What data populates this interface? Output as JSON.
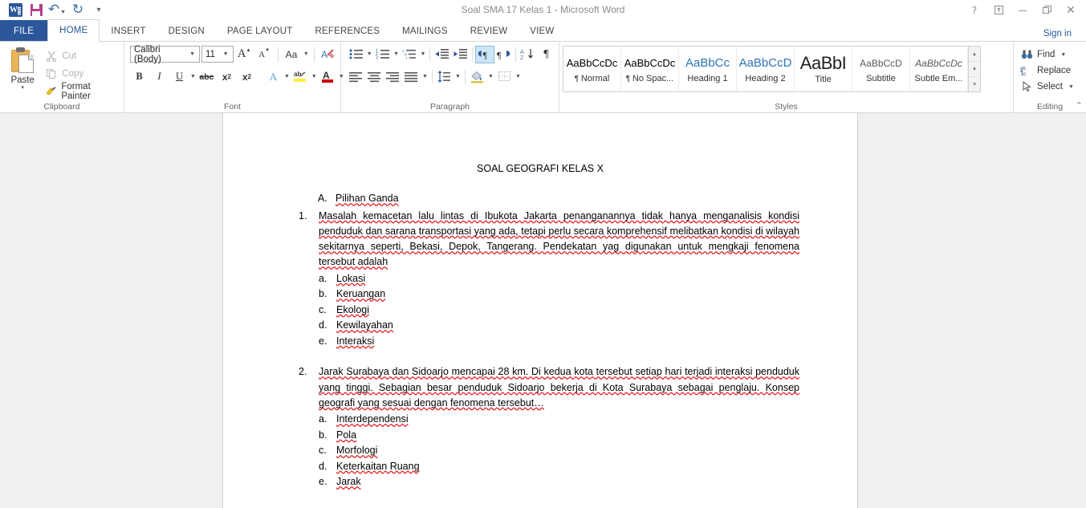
{
  "window": {
    "title": "Soal SMA 17 Kelas 1 - Microsoft Word",
    "quick_access": [
      {
        "name": "word-logo",
        "label": "W"
      },
      {
        "name": "save",
        "label": "Save"
      },
      {
        "name": "undo",
        "label": "↶"
      },
      {
        "name": "redo",
        "label": "↻"
      },
      {
        "name": "customize",
        "label": "–"
      }
    ],
    "controls": {
      "help": "?",
      "ribbon_display_options": "⤒",
      "minimize": "—",
      "restore": "❐",
      "close": "✕"
    },
    "sign_in": "Sign in"
  },
  "tabs": [
    {
      "label": "FILE",
      "active": false,
      "file": true
    },
    {
      "label": "HOME",
      "active": true,
      "file": false
    },
    {
      "label": "INSERT",
      "active": false,
      "file": false
    },
    {
      "label": "DESIGN",
      "active": false,
      "file": false
    },
    {
      "label": "PAGE LAYOUT",
      "active": false,
      "file": false
    },
    {
      "label": "REFERENCES",
      "active": false,
      "file": false
    },
    {
      "label": "MAILINGS",
      "active": false,
      "file": false
    },
    {
      "label": "REVIEW",
      "active": false,
      "file": false
    },
    {
      "label": "VIEW",
      "active": false,
      "file": false
    }
  ],
  "ribbon": {
    "collapse_label": "⌃",
    "clipboard": {
      "group_label": "Clipboard",
      "paste_label": "Paste",
      "paste_arrow": "▾",
      "commands": [
        {
          "label": "Cut",
          "icon": "scissors-icon",
          "glyph": "✂",
          "disabled": true
        },
        {
          "label": "Copy",
          "icon": "copy-icon",
          "glyph": "⧉",
          "disabled": true
        },
        {
          "label": "Format Painter",
          "icon": "format-painter-icon",
          "glyph": "✒",
          "disabled": false
        }
      ]
    },
    "font": {
      "group_label": "Font",
      "font_name": "Calibri (Body)",
      "font_size": "11",
      "grow_font": "A",
      "shrink_font": "A",
      "change_case": "Aa",
      "clear_formatting": "A",
      "bold": "B",
      "italic": "I",
      "underline": "U",
      "strikethrough": "abc",
      "subscript_base": "x",
      "subscript_sup": "2",
      "superscript_base": "x",
      "superscript_sup": "2",
      "text_effects": "A",
      "highlight": "ab",
      "font_color": "A"
    },
    "paragraph": {
      "group_label": "Paragraph",
      "bullets": "•–",
      "numbering": "1–2–3",
      "multilevel": "≡",
      "decrease_indent": "←≡",
      "increase_indent": "→≡",
      "ltr": "¶",
      "rtl": "¶",
      "sort": "A↓",
      "show_marks": "¶",
      "align_left": "≡",
      "align_center": "≡",
      "align_right": "≡",
      "justify": "≡",
      "line_spacing": "↕",
      "shading": "■",
      "borders": "▦"
    },
    "styles": {
      "group_label": "Styles",
      "items": [
        {
          "preview": "AaBbCcDc",
          "name": "Normal",
          "pilcrow": true,
          "kind": "normal"
        },
        {
          "preview": "AaBbCcDc",
          "name": "No Spac...",
          "pilcrow": true,
          "kind": "normal"
        },
        {
          "preview": "AaBbCc",
          "name": "Heading 1",
          "pilcrow": false,
          "kind": "head"
        },
        {
          "preview": "AaBbCcD",
          "name": "Heading 2",
          "pilcrow": false,
          "kind": "head"
        },
        {
          "preview": "AaBbI",
          "name": "Title",
          "pilcrow": false,
          "kind": "title"
        },
        {
          "preview": "AaBbCcD",
          "name": "Subtitle",
          "pilcrow": false,
          "kind": "sub"
        },
        {
          "preview": "AaBbCcDc",
          "name": "Subtle Em...",
          "pilcrow": false,
          "kind": "em"
        }
      ],
      "scroll_up": "▴",
      "scroll_down": "▾",
      "more": "≡"
    },
    "editing": {
      "group_label": "Editing",
      "commands": [
        {
          "label": "Find",
          "icon": "binoculars-icon",
          "glyph": "⚲",
          "caret": true
        },
        {
          "label": "Replace",
          "icon": "replace-icon",
          "glyph": "ab",
          "caret": false
        },
        {
          "label": "Select",
          "icon": "cursor-icon",
          "glyph": "➤",
          "caret": true
        }
      ]
    }
  },
  "document": {
    "title": "SOAL GEOGRAFI KELAS X",
    "section": {
      "marker": "A.",
      "heading": "Pilihan Ganda"
    },
    "questions": [
      {
        "number": "1.",
        "text": "Masalah kemacetan lalu lintas di Ibukota Jakarta penanganannya tidak hanya menganalisis kondisi penduduk dan sarana transportasi yang ada, tetapi perlu secara komprehensif melibatkan kondisi di wilayah sekitarnya seperti, Bekasi, Depok, Tangerang. Pendekatan yag digunakan untuk mengkaji fenomena tersebut adalah",
        "options": [
          {
            "letter": "a.",
            "text": "Lokasi"
          },
          {
            "letter": "b.",
            "text": "Keruangan"
          },
          {
            "letter": "c.",
            "text": "Ekologi"
          },
          {
            "letter": "d.",
            "text": "Kewilayahan"
          },
          {
            "letter": "e.",
            "text": "Interaksi"
          }
        ]
      },
      {
        "number": "2.",
        "text": "Jarak Surabaya dan Sidoarjo mencapai 28 km. Di kedua kota tersebut setiap hari terjadi interaksi penduduk yang tinggi. Sebagian besar penduduk Sidoarjo bekerja di Kota Surabaya sebagai penglaju. Konsep geografi yang sesuai dengan fenomena tersebut…",
        "options": [
          {
            "letter": "a.",
            "text": "Interdependensi"
          },
          {
            "letter": "b.",
            "text": "Pola"
          },
          {
            "letter": "c.",
            "text": "Morfologi"
          },
          {
            "letter": "d.",
            "text": "Keterkaitan Ruang"
          },
          {
            "letter": "e.",
            "text": "Jarak"
          }
        ]
      }
    ]
  },
  "colors": {
    "brand": "#2b579a",
    "spell_error": "#e02020",
    "heading_style": "#2e74b5",
    "ribbon_bg": "#ffffff",
    "doc_bg": "#f0f0f0"
  }
}
